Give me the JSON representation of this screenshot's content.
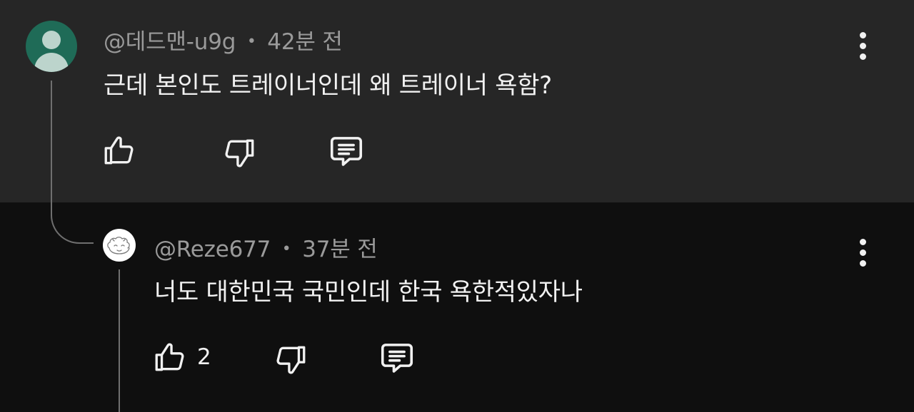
{
  "comments": [
    {
      "author": "@데드맨-u9g",
      "separator": "•",
      "time": "42분 전",
      "text": "근데 본인도 트레이너인데 왜 트레이너 욕함?",
      "avatar_icon": "default-person-icon",
      "like_count": ""
    },
    {
      "author": "@Reze677",
      "separator": "•",
      "time": "37분 전",
      "text": "너도 대한민국 국민인데 한국 욕한적있자나",
      "avatar_icon": "sketch-face-avatar",
      "like_count": "2"
    }
  ],
  "icons": {
    "like": "thumbs-up-icon",
    "dislike": "thumbs-down-icon",
    "reply": "comment-reply-icon",
    "more": "more-vertical-icon"
  },
  "colors": {
    "parent_background": "#262626",
    "reply_background": "#0f0f0f",
    "primary_text": "#f1f1f1",
    "secondary_text": "#9a9a9a",
    "avatar_green": "#1f6b57",
    "thread_line": "#6f6f6f"
  }
}
